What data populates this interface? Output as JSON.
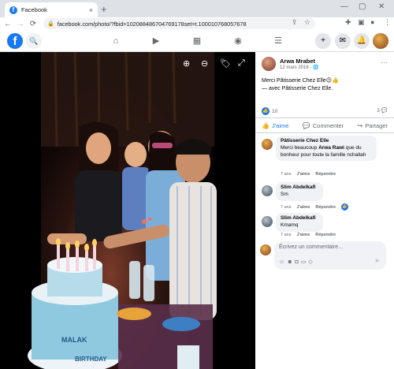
{
  "browser": {
    "tab_title": "Facebook",
    "tab_close": "×",
    "new_tab": "+",
    "win_min": "—",
    "win_max": "▢",
    "win_close": "✕",
    "url": "facebook.com/photo/?fbid=102088486704769178set=t.100010768057678",
    "nav_back": "←",
    "nav_forward": "→",
    "nav_reload": "⟳"
  },
  "fb": {
    "logo": "f",
    "nav_icons": [
      "home-icon",
      "video-icon",
      "marketplace-icon",
      "groups-icon",
      "menu-icon"
    ]
  },
  "post": {
    "author": "Arwa Mrabet",
    "date": "12 mars 2016 · 🌐",
    "text_line1": "Merci Pâtisserie Chez Elle😉👍",
    "text_line2": "— avec Pâtisserie Chez Elle.",
    "like_count": "10",
    "comment_count": "3",
    "more": "···",
    "like_label": "J'aime",
    "comment_label": "Commenter",
    "share_label": "Partager"
  },
  "comments": [
    {
      "name": "Pâtisserie Chez Elle",
      "text_pre": "Merci beaucoup ",
      "text_bold": "Arwa Rawi",
      "text_post": " que du bonheur pour toute la famille nchallah",
      "age": "7 ans",
      "like": "J'aime",
      "reply": "Répondre"
    },
    {
      "name": "Slim Abdelkafi",
      "text": "Sm",
      "age": "7 ans",
      "like": "J'aime",
      "reply": "Répondre"
    },
    {
      "name": "Slim Abdelkafi",
      "text": "Kmamq",
      "age": "7 ans",
      "like": "J'aime",
      "reply": "Répondre"
    }
  ],
  "compose": {
    "placeholder": "Écrivez un commentaire…"
  },
  "colors": {
    "fb_blue": "#1877f2",
    "text_secondary": "#65676b",
    "bubble_bg": "#f0f2f5"
  }
}
